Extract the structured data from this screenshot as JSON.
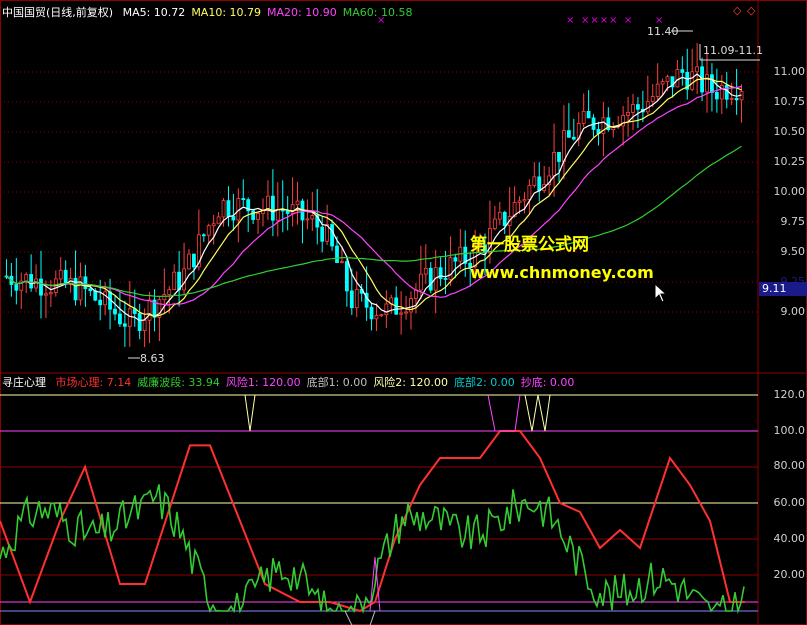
{
  "main_panel": {
    "title": "中国国贸(日线,前复权)",
    "indicators": [
      {
        "label": "MA5: 10.72",
        "color": "#ffffff"
      },
      {
        "label": "MA10: 10.79",
        "color": "#ffff66"
      },
      {
        "label": "MA20: 10.90",
        "color": "#ff44ff"
      },
      {
        "label": "MA60: 10.58",
        "color": "#33cc33"
      }
    ],
    "y_axis_ticks": [
      "11.00",
      "10.75",
      "10.50",
      "10.25",
      "10.00",
      "9.75",
      "9.50",
      "9.25",
      "9.00"
    ],
    "high_label": "11.40",
    "low_label": "8.63",
    "range_label": "11.09-11.1",
    "current_price": "9.11",
    "markers": [
      "×",
      "×",
      "××××",
      "×",
      "×"
    ],
    "top_right_icons": [
      "◇",
      "◇"
    ]
  },
  "indicator_panel": {
    "title": "寻庄心理",
    "items": [
      {
        "label": "市场心理: 7.14",
        "color": "#ff3030"
      },
      {
        "label": "威廉波段: 33.94",
        "color": "#33cc33"
      },
      {
        "label": "风险1: 120.00",
        "color": "#ff44ff"
      },
      {
        "label": "底部1: 0.00",
        "color": "#c0c0c0"
      },
      {
        "label": "风险2: 120.00",
        "color": "#ffffaa"
      },
      {
        "label": "底部2: 0.00",
        "color": "#00cccc"
      },
      {
        "label": "抄底: 0.00",
        "color": "#ff44ff"
      }
    ],
    "y_axis_ticks": [
      "120.0",
      "100.0",
      "80.00",
      "60.00",
      "40.00",
      "20.00"
    ]
  },
  "watermark": {
    "line1": "第一股票公式网",
    "line2": "www.chnmoney.com"
  },
  "colors": {
    "background": "#000000",
    "grid_red": "#8b0000",
    "up": "#ff4040",
    "down": "#00ffff",
    "ma5": "#ffffff",
    "ma10": "#ffff66",
    "ma20": "#ff44ff",
    "ma60": "#33cc33"
  }
}
